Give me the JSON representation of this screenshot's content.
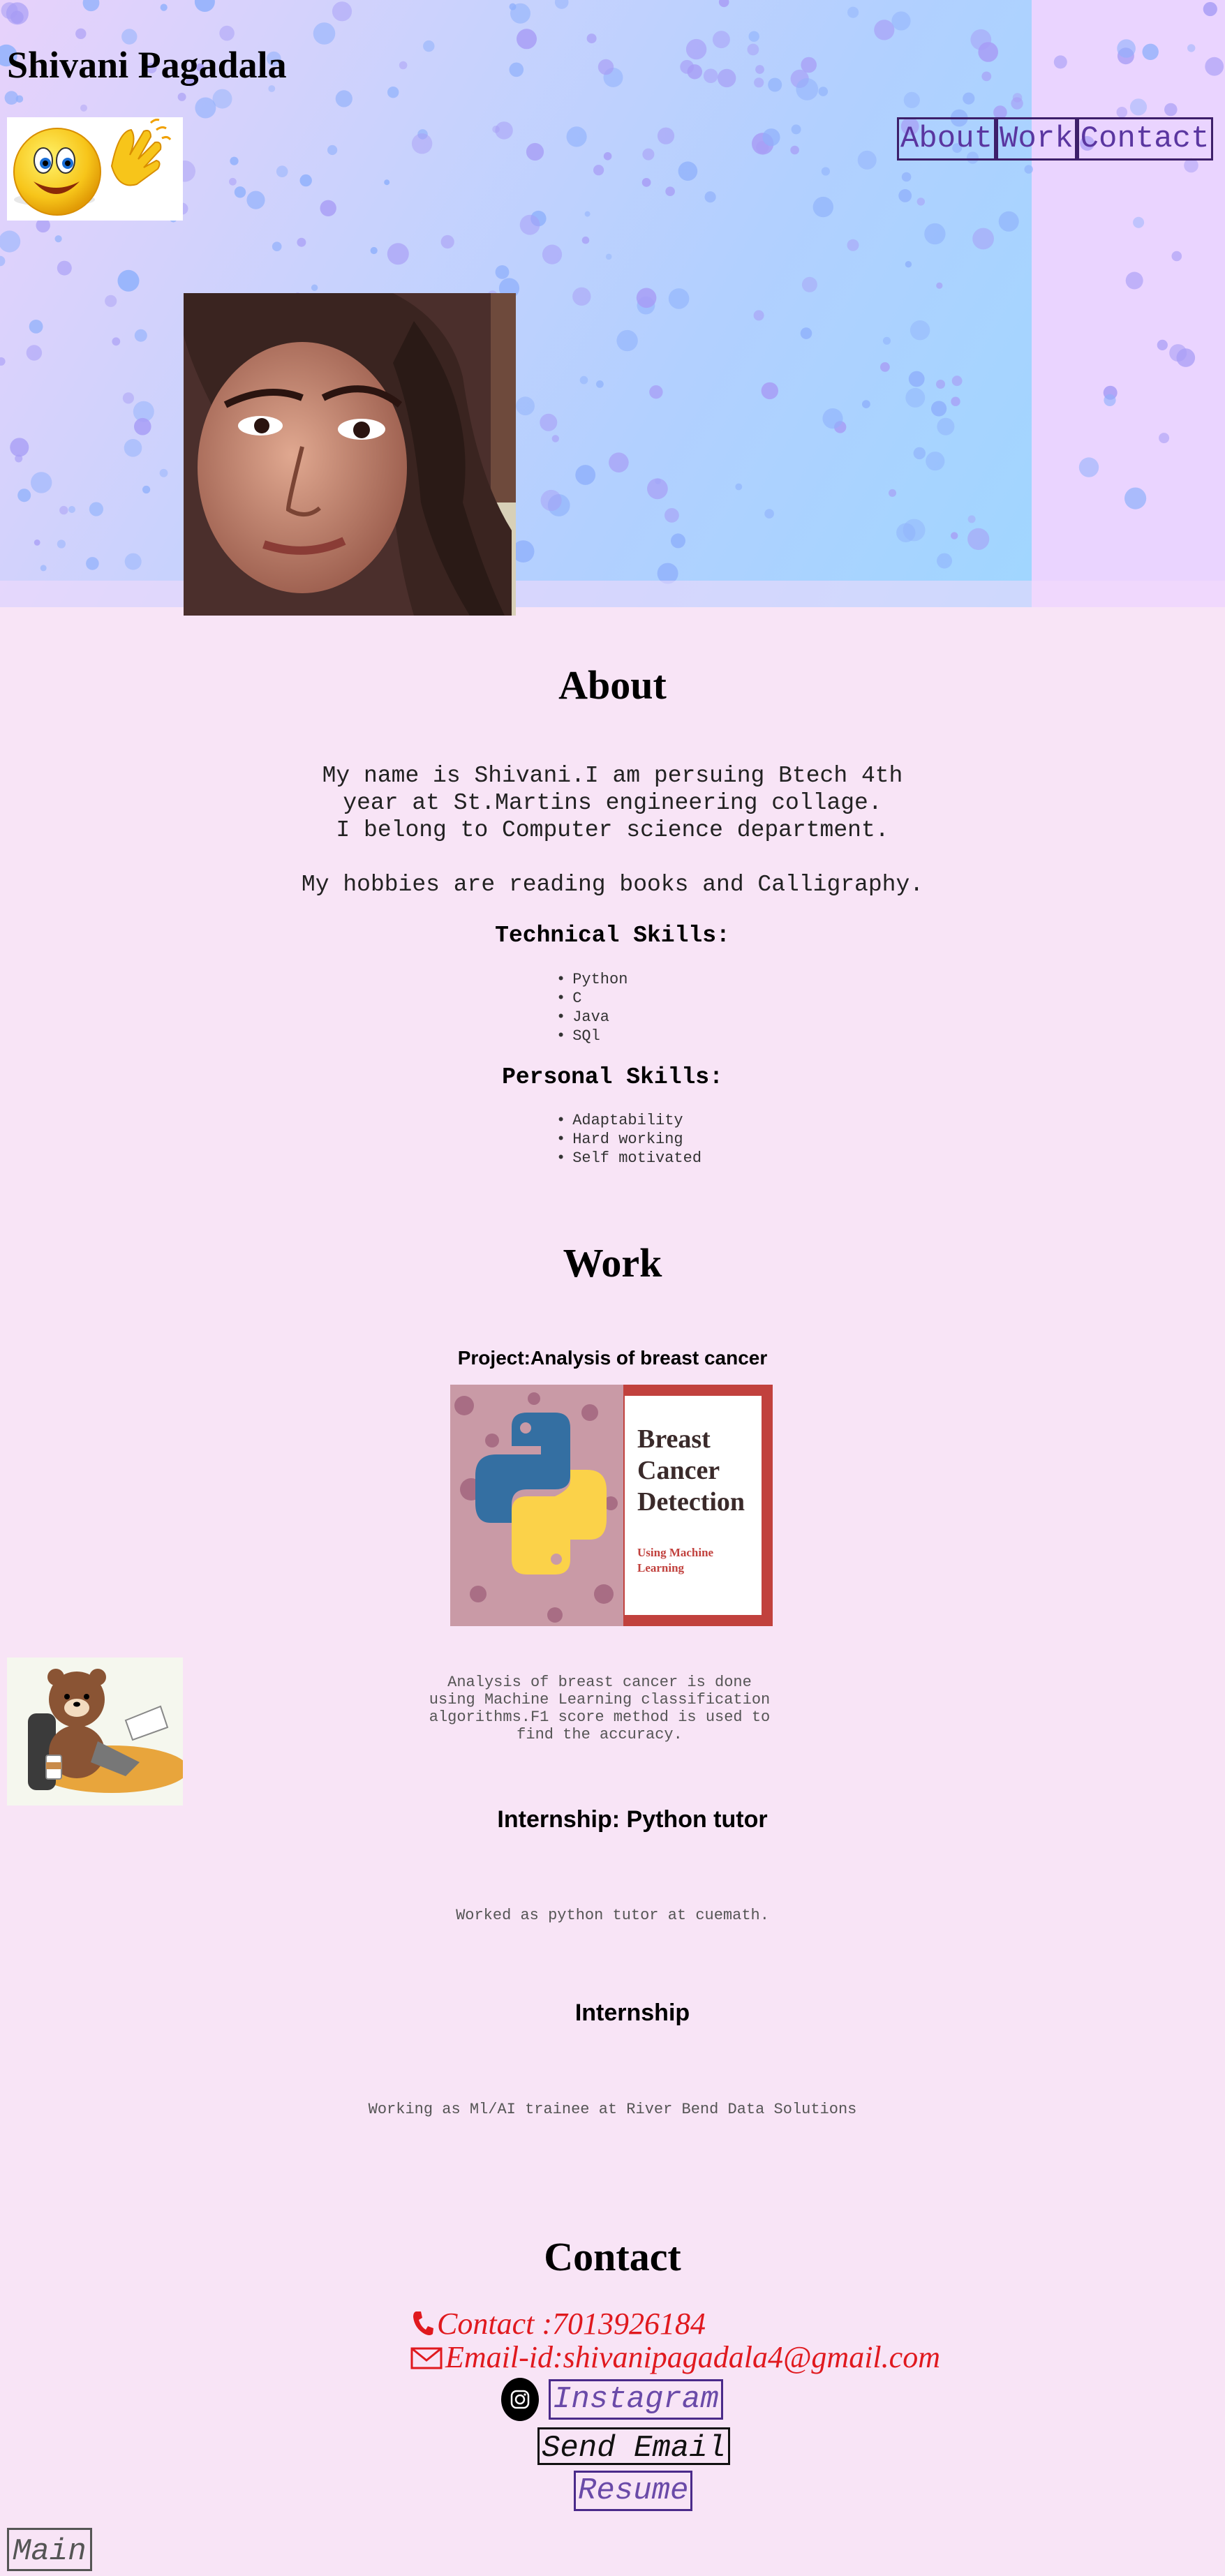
{
  "header": {
    "site_title": "Shivani Pagadala",
    "nav": [
      {
        "label": "About"
      },
      {
        "label": "Work"
      },
      {
        "label": "Contact"
      }
    ]
  },
  "about": {
    "heading": "About",
    "intro": [
      "My name is Shivani.I am persuing Btech 4th",
      "year at St.Martins engineering collage.",
      "I belong to Computer science department."
    ],
    "hobbies": "My hobbies are reading books and Calligraphy.",
    "technical_heading": "Technical Skills:",
    "technical_skills": [
      "Python",
      "C",
      "Java",
      "SQl"
    ],
    "personal_heading": "Personal Skills:",
    "personal_skills": [
      "Adaptability",
      "Hard working",
      "Self motivated"
    ]
  },
  "work": {
    "heading": "Work",
    "project_title": "Project:Analysis of breast cancer",
    "project_image_text": [
      "Breast",
      "Cancer",
      "Detection"
    ],
    "project_image_subtext": [
      "Using Machine",
      "Learning"
    ],
    "project_desc": [
      "Analysis of breast cancer is done",
      "using Machine Learning classification",
      "algorithms.F1 score method is used to",
      "find the accuracy."
    ],
    "internship1_title": "Internship: Python tutor",
    "internship1_desc": "Worked as python tutor at cuemath.",
    "internship2_title": "Internship",
    "internship2_desc": "Working as Ml/AI trainee at River Bend Data Solutions"
  },
  "contact": {
    "heading": "Contact",
    "phone": "Contact :7013926184",
    "email": "Email-id:shivanipagadala4@gmail.com",
    "instagram_label": "Instagram",
    "send_email_label": "Send Email",
    "resume_label": "Resume"
  },
  "footer": {
    "main_label": "Main"
  },
  "colors": {
    "page_bg": "#f8e4f6",
    "contact_red": "#e0191e",
    "nav_border": "#3d1f6a",
    "nav_text": "#5a36a0"
  },
  "icons": {
    "phone": "phone-icon",
    "email": "envelope-icon",
    "instagram": "instagram-icon"
  }
}
